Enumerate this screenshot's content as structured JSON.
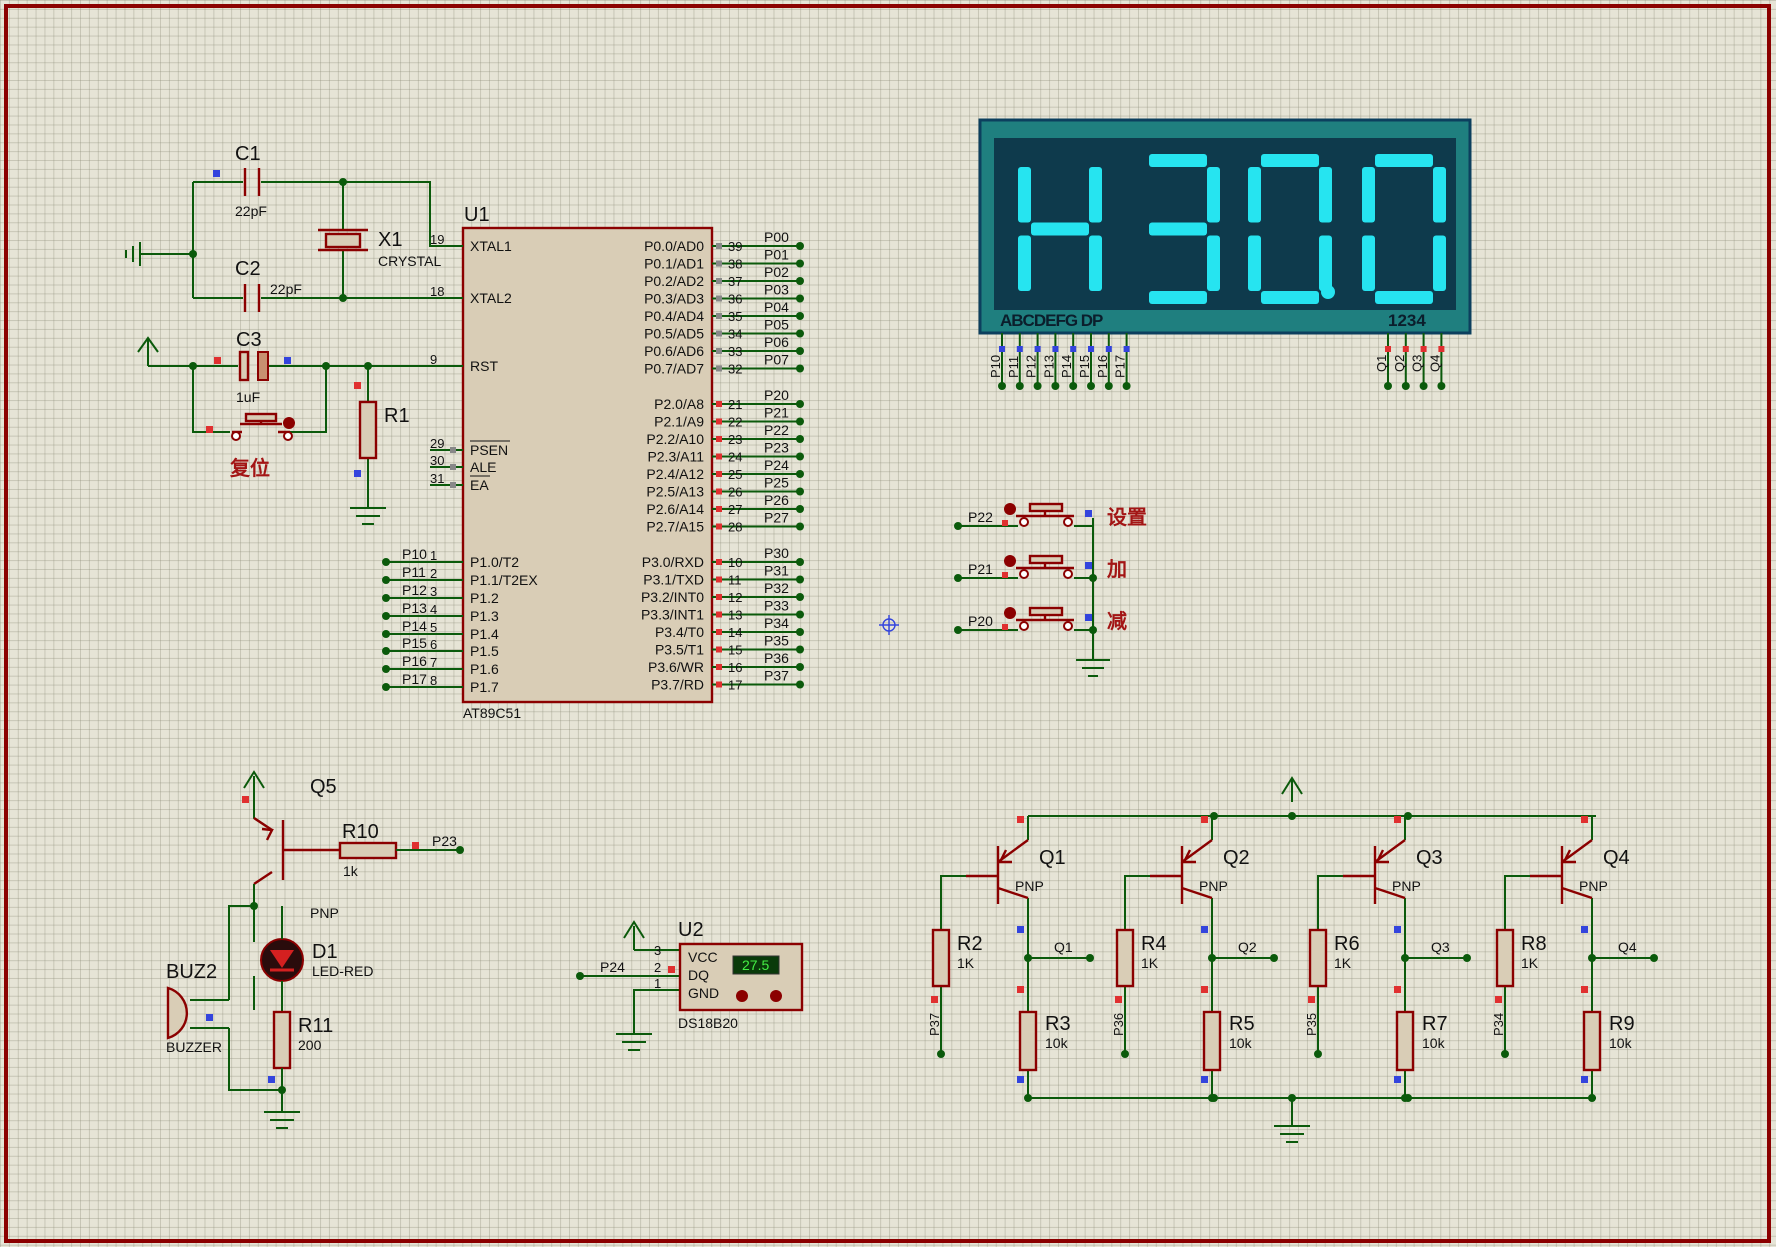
{
  "border_color": "#8b0000",
  "wire_color": "#0b5a0b",
  "component_color": "#8b0000",
  "display": {
    "text": "H30.0",
    "digits": [
      "H",
      "3",
      "0",
      "0"
    ],
    "segment_color": "#26e4f0",
    "body_color": "#1f7f7f",
    "face_color": "#0e3a4c",
    "seg_label": "ABCDEFG  DP",
    "dig_label": "1234",
    "seg_pins": [
      "P10",
      "P11",
      "P12",
      "P13",
      "P14",
      "P15",
      "P16",
      "P17"
    ],
    "dig_pins": [
      "Q1",
      "Q2",
      "Q3",
      "Q4"
    ]
  },
  "mcu": {
    "ref": "U1",
    "part": "AT89C51",
    "left_pins": [
      {
        "num": "19",
        "name": "XTAL1"
      },
      {
        "num": "18",
        "name": "XTAL2"
      },
      {
        "num": "9",
        "name": "RST"
      },
      {
        "num": "29",
        "name": "PSEN"
      },
      {
        "num": "30",
        "name": "ALE"
      },
      {
        "num": "31",
        "name": "EA"
      },
      {
        "num": "1",
        "name": "P1.0/T2",
        "net": "P10"
      },
      {
        "num": "2",
        "name": "P1.1/T2EX",
        "net": "P11"
      },
      {
        "num": "3",
        "name": "P1.2",
        "net": "P12"
      },
      {
        "num": "4",
        "name": "P1.3",
        "net": "P13"
      },
      {
        "num": "5",
        "name": "P1.4",
        "net": "P14"
      },
      {
        "num": "6",
        "name": "P1.5",
        "net": "P15"
      },
      {
        "num": "7",
        "name": "P1.6",
        "net": "P16"
      },
      {
        "num": "8",
        "name": "P1.7",
        "net": "P17"
      }
    ],
    "right_pins": [
      {
        "num": "39",
        "name": "P0.0/AD0",
        "net": "P00"
      },
      {
        "num": "38",
        "name": "P0.1/AD1",
        "net": "P01"
      },
      {
        "num": "37",
        "name": "P0.2/AD2",
        "net": "P02"
      },
      {
        "num": "36",
        "name": "P0.3/AD3",
        "net": "P03"
      },
      {
        "num": "35",
        "name": "P0.4/AD4",
        "net": "P04"
      },
      {
        "num": "34",
        "name": "P0.5/AD5",
        "net": "P05"
      },
      {
        "num": "33",
        "name": "P0.6/AD6",
        "net": "P06"
      },
      {
        "num": "32",
        "name": "P0.7/AD7",
        "net": "P07"
      },
      {
        "num": "21",
        "name": "P2.0/A8",
        "net": "P20"
      },
      {
        "num": "22",
        "name": "P2.1/A9",
        "net": "P21"
      },
      {
        "num": "23",
        "name": "P2.2/A10",
        "net": "P22"
      },
      {
        "num": "24",
        "name": "P2.3/A11",
        "net": "P23"
      },
      {
        "num": "25",
        "name": "P2.4/A12",
        "net": "P24"
      },
      {
        "num": "26",
        "name": "P2.5/A13",
        "net": "P25"
      },
      {
        "num": "27",
        "name": "P2.6/A14",
        "net": "P26"
      },
      {
        "num": "28",
        "name": "P2.7/A15",
        "net": "P27"
      },
      {
        "num": "10",
        "name": "P3.0/RXD",
        "net": "P30"
      },
      {
        "num": "11",
        "name": "P3.1/TXD",
        "net": "P31"
      },
      {
        "num": "12",
        "name": "P3.2/INT0",
        "net": "P32"
      },
      {
        "num": "13",
        "name": "P3.3/INT1",
        "net": "P33"
      },
      {
        "num": "14",
        "name": "P3.4/T0",
        "net": "P34"
      },
      {
        "num": "15",
        "name": "P3.5/T1",
        "net": "P35"
      },
      {
        "num": "16",
        "name": "P3.6/WR",
        "net": "P36"
      },
      {
        "num": "17",
        "name": "P3.7/RD",
        "net": "P37"
      }
    ]
  },
  "components": {
    "c1": {
      "ref": "C1",
      "value": "22pF"
    },
    "c2": {
      "ref": "C2",
      "value": "22pF"
    },
    "c3": {
      "ref": "C3",
      "value": "1uF"
    },
    "x1": {
      "ref": "X1",
      "value": "CRYSTAL"
    },
    "r1": {
      "ref": "R1"
    },
    "reset_label": "复位",
    "q5": {
      "ref": "Q5",
      "type": "PNP"
    },
    "r10": {
      "ref": "R10",
      "value": "1k",
      "net": "P23"
    },
    "d1": {
      "ref": "D1",
      "value": "LED-RED"
    },
    "r11": {
      "ref": "R11",
      "value": "200"
    },
    "buz2": {
      "ref": "BUZ2",
      "value": "BUZZER"
    },
    "u2": {
      "ref": "U2",
      "part": "DS18B20",
      "temp": "27.5",
      "net": "P24",
      "pins": [
        {
          "num": "3",
          "name": "VCC"
        },
        {
          "num": "2",
          "name": "DQ"
        },
        {
          "num": "1",
          "name": "GND"
        }
      ]
    }
  },
  "buttons": [
    {
      "net": "P22",
      "label": "设置"
    },
    {
      "net": "P21",
      "label": "加"
    },
    {
      "net": "P20",
      "label": "减"
    }
  ],
  "drivers": [
    {
      "q": "Q1",
      "type": "PNP",
      "rb": "R2",
      "rb_val": "1K",
      "rc": "R3",
      "rc_val": "10k",
      "out": "Q1",
      "in": "P37"
    },
    {
      "q": "Q2",
      "type": "PNP",
      "rb": "R4",
      "rb_val": "1K",
      "rc": "R5",
      "rc_val": "10k",
      "out": "Q2",
      "in": "P36"
    },
    {
      "q": "Q3",
      "type": "PNP",
      "rb": "R6",
      "rb_val": "1K",
      "rc": "R7",
      "rc_val": "10k",
      "out": "Q3",
      "in": "P35"
    },
    {
      "q": "Q4",
      "type": "PNP",
      "rb": "R8",
      "rb_val": "1K",
      "rc": "R9",
      "rc_val": "10k",
      "out": "Q4",
      "in": "P34"
    }
  ]
}
